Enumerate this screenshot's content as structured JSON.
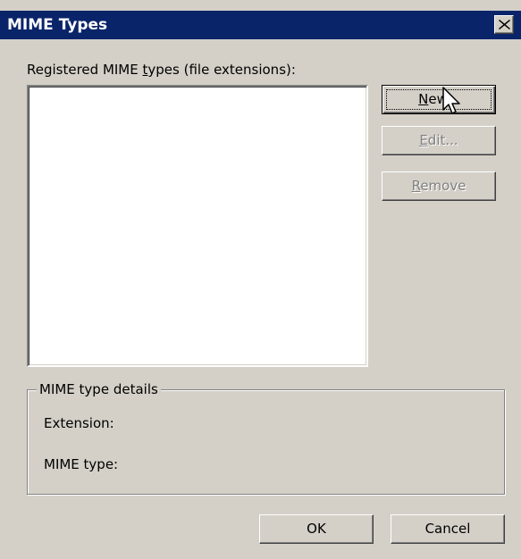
{
  "window": {
    "title": "MIME Types"
  },
  "list": {
    "label_pre": "Registered MIME ",
    "label_ul": "t",
    "label_post": "ypes (file extensions):",
    "items": []
  },
  "buttons": {
    "new": {
      "ul": "N",
      "rest": "ew..."
    },
    "edit": {
      "ul": "E",
      "rest": "dit..."
    },
    "remove": {
      "ul": "R",
      "rest": "emove"
    },
    "ok": "OK",
    "cancel": "Cancel"
  },
  "details": {
    "group_label": "MIME type details",
    "extension_label": "Extension:",
    "mime_type_label": "MIME type:"
  },
  "icons": {
    "close": "close-icon",
    "cursor": "mouse-pointer-icon"
  },
  "colors": {
    "titlebar": "#0a246a",
    "dialog_face": "#d4d0c8",
    "disabled_text": "#808080"
  }
}
